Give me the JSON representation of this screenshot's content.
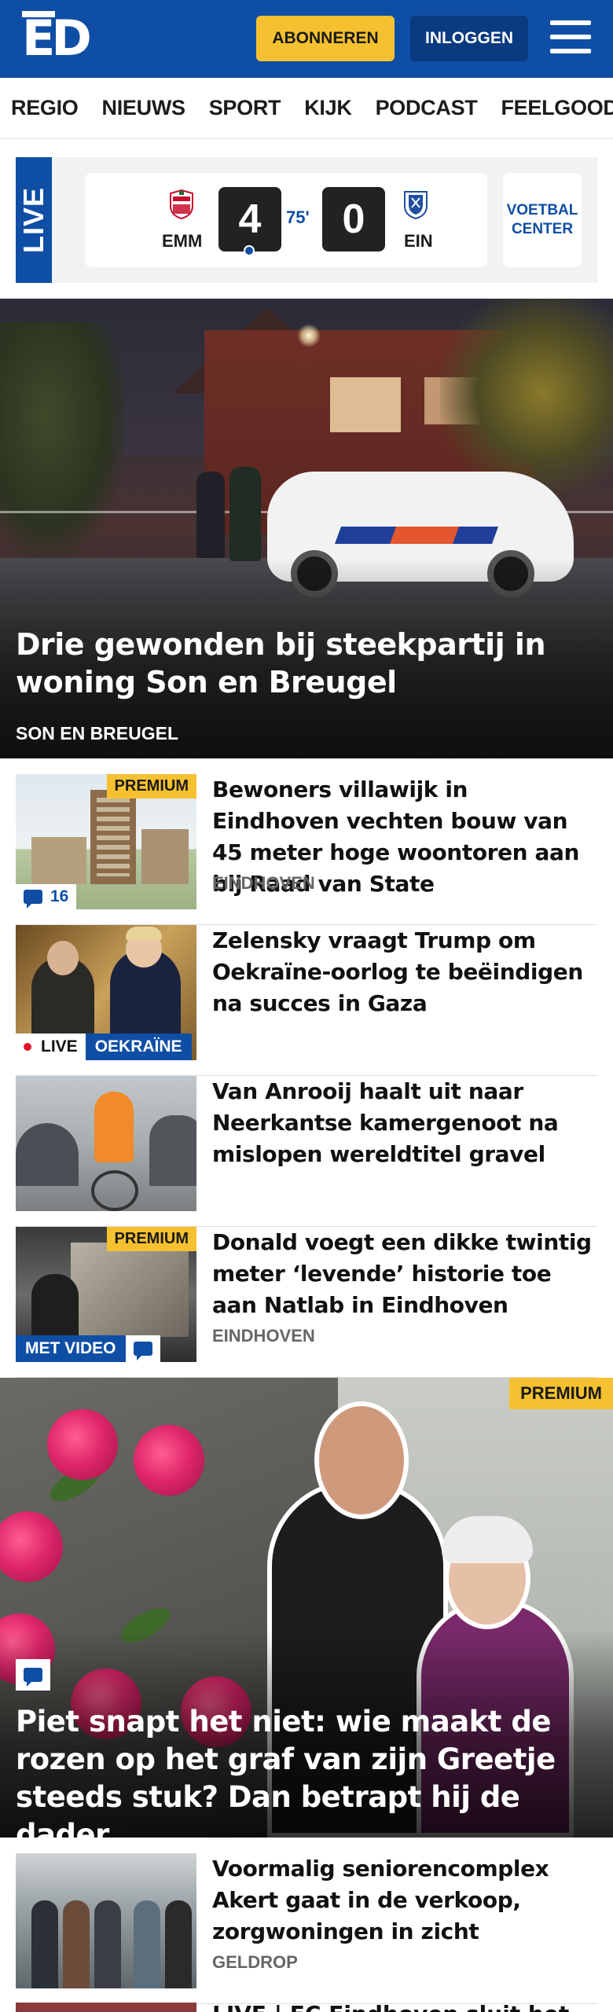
{
  "header": {
    "logo": "ED",
    "subscribe_label": "ABONNEREN",
    "login_label": "INLOGGEN",
    "brand_color": "#0f4ea5",
    "accent_color": "#f6c130",
    "menu_icon": "hamburger-icon"
  },
  "nav": {
    "items": [
      "REGIO",
      "NIEUWS",
      "SPORT",
      "KIJK",
      "PODCAST",
      "FEELGOOD"
    ]
  },
  "live": {
    "tab_label": "LIVE",
    "home_team": "EMM",
    "away_team": "EIN",
    "home_score": "4",
    "away_score": "0",
    "minute": "75'",
    "voetbal_center_line1": "VOETBAL",
    "voetbal_center_line2": "CENTER"
  },
  "hero": {
    "title": "Drie gewonden bij steekpartij in woning Son en Breugel",
    "location": "SON EN BREUGEL"
  },
  "articles": [
    {
      "title": "Bewoners villawijk in Eindhoven vechten bouw van 45 meter hoge woontoren aan bij Raad van State",
      "location": "EINDHOVEN",
      "premium_label": "PREMIUM",
      "comment_count": "16"
    },
    {
      "title": "Zelensky vraagt Trump om Oekraïne-oorlog te beëindigen na succes in Gaza",
      "live_label": "LIVE",
      "tag": "OEKRAÏNE"
    },
    {
      "title": "Van Anrooij haalt uit naar Neerkantse kamergenoot na mislopen wereldtitel gravel"
    },
    {
      "title": "Donald voegt een dikke twintig meter ‘levende’ historie toe aan Natlab in Eindhoven",
      "location": "EINDHOVEN",
      "premium_label": "PREMIUM",
      "video_label": "MET VIDEO"
    }
  ],
  "feature": {
    "premium_label": "PREMIUM",
    "title": "Piet snapt het niet: wie maakt de rozen op het graf van zijn Greetje steeds stuk? Dan betrapt hij de dader"
  },
  "article_after": {
    "title": "Voormalig seniorencomplex Akert gaat in de verkoop, zorgwoningen in zicht",
    "location": "GELDROP"
  },
  "partial_article": {
    "title": "LIVE | FC Eindhoven sluit het..."
  }
}
